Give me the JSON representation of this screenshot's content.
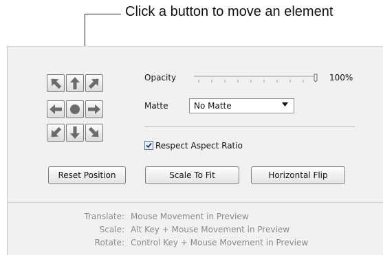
{
  "callout": {
    "text": "Click a button to move an element"
  },
  "opacity": {
    "label": "Opacity",
    "value_text": "100%",
    "value": 100
  },
  "matte": {
    "label": "Matte",
    "selected": "No Matte"
  },
  "respect_aspect": {
    "label": "Respect Aspect Ratio",
    "checked": true
  },
  "buttons": {
    "reset": "Reset Position",
    "scale_to_fit": "Scale To Fit",
    "horizontal_flip": "Horizontal Flip"
  },
  "nudge": {
    "directions": [
      "up-left",
      "up",
      "up-right",
      "left",
      "center",
      "right",
      "down-left",
      "down",
      "down-right"
    ]
  },
  "help": [
    {
      "key": "Translate:",
      "value": "Mouse Movement in Preview"
    },
    {
      "key": "Scale:",
      "value": "Alt Key + Mouse Movement in Preview"
    },
    {
      "key": "Rotate:",
      "value": "Control Key + Mouse Movement in Preview"
    }
  ],
  "colors": {
    "panel_bg": "#f1f1f1",
    "arrow_fill": "#6b6b6b",
    "help_text": "#8a8a8a"
  }
}
